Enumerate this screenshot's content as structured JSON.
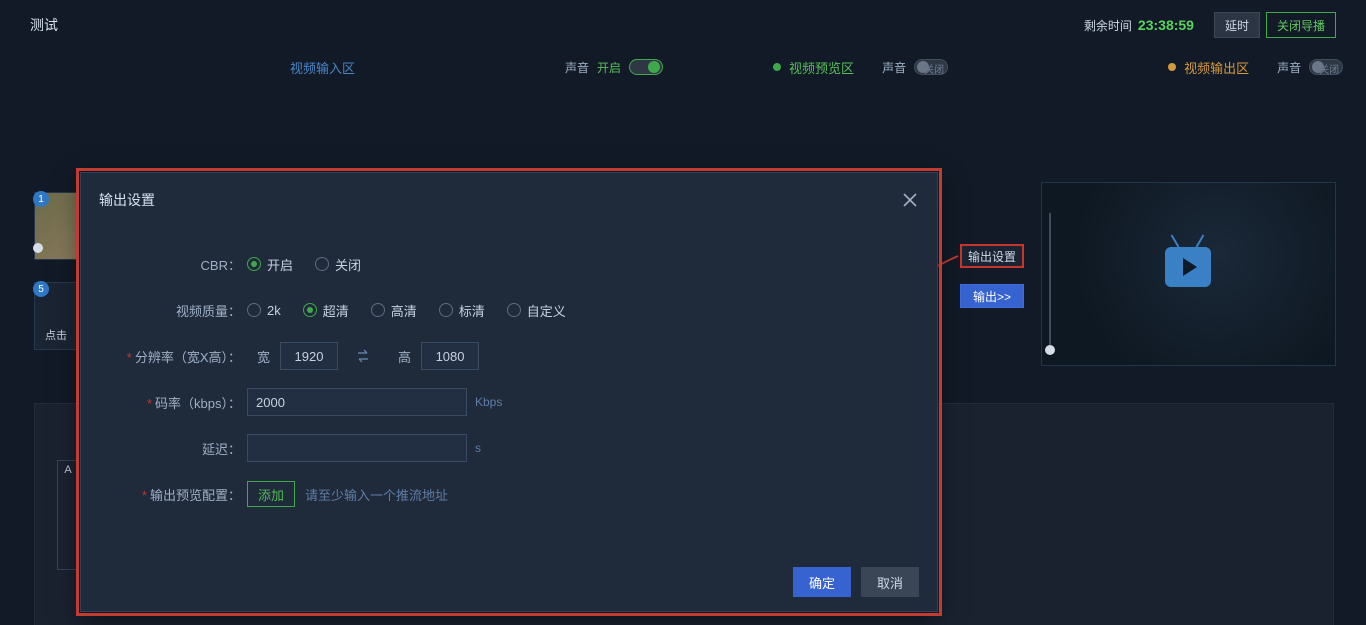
{
  "topbar": {
    "title": "测试",
    "time_label": "剩余时间",
    "time_value": "23:38:59",
    "delay_btn": "延时",
    "close_btn": "关闭导播"
  },
  "sectionbar": {
    "input_title": "视频输入区",
    "sound_label": "声音",
    "sound_on": "开启",
    "preview_title": "视频预览区",
    "sound_off_txt": "关闭",
    "output_title": "视频输出区"
  },
  "thumbs": {
    "badge1": "1",
    "badge5": "5",
    "caption5": "点击"
  },
  "side": {
    "settings_btn": "输出设置",
    "output_btn": "输出>>"
  },
  "lower": {
    "cell_label": "A"
  },
  "modal": {
    "title": "输出设置",
    "cbr_label": "CBR：",
    "cbr_on": "开启",
    "cbr_off": "关闭",
    "quality_label": "视频质量：",
    "quality_options": {
      "q2k": "2k",
      "uhd": "超清",
      "hd": "高清",
      "sd": "标清",
      "custom": "自定义"
    },
    "resolution_label": "分辨率（宽X高）：",
    "width_label": "宽",
    "height_label": "高",
    "width_value": "1920",
    "height_value": "1080",
    "bitrate_label": "码率（kbps）：",
    "bitrate_value": "2000",
    "bitrate_unit": "Kbps",
    "delay_label": "延迟：",
    "delay_value": "",
    "delay_unit": "s",
    "output_cfg_label": "输出预览配置：",
    "add_btn": "添加",
    "hint": "请至少输入一个推流地址",
    "ok": "确定",
    "cancel": "取消"
  }
}
